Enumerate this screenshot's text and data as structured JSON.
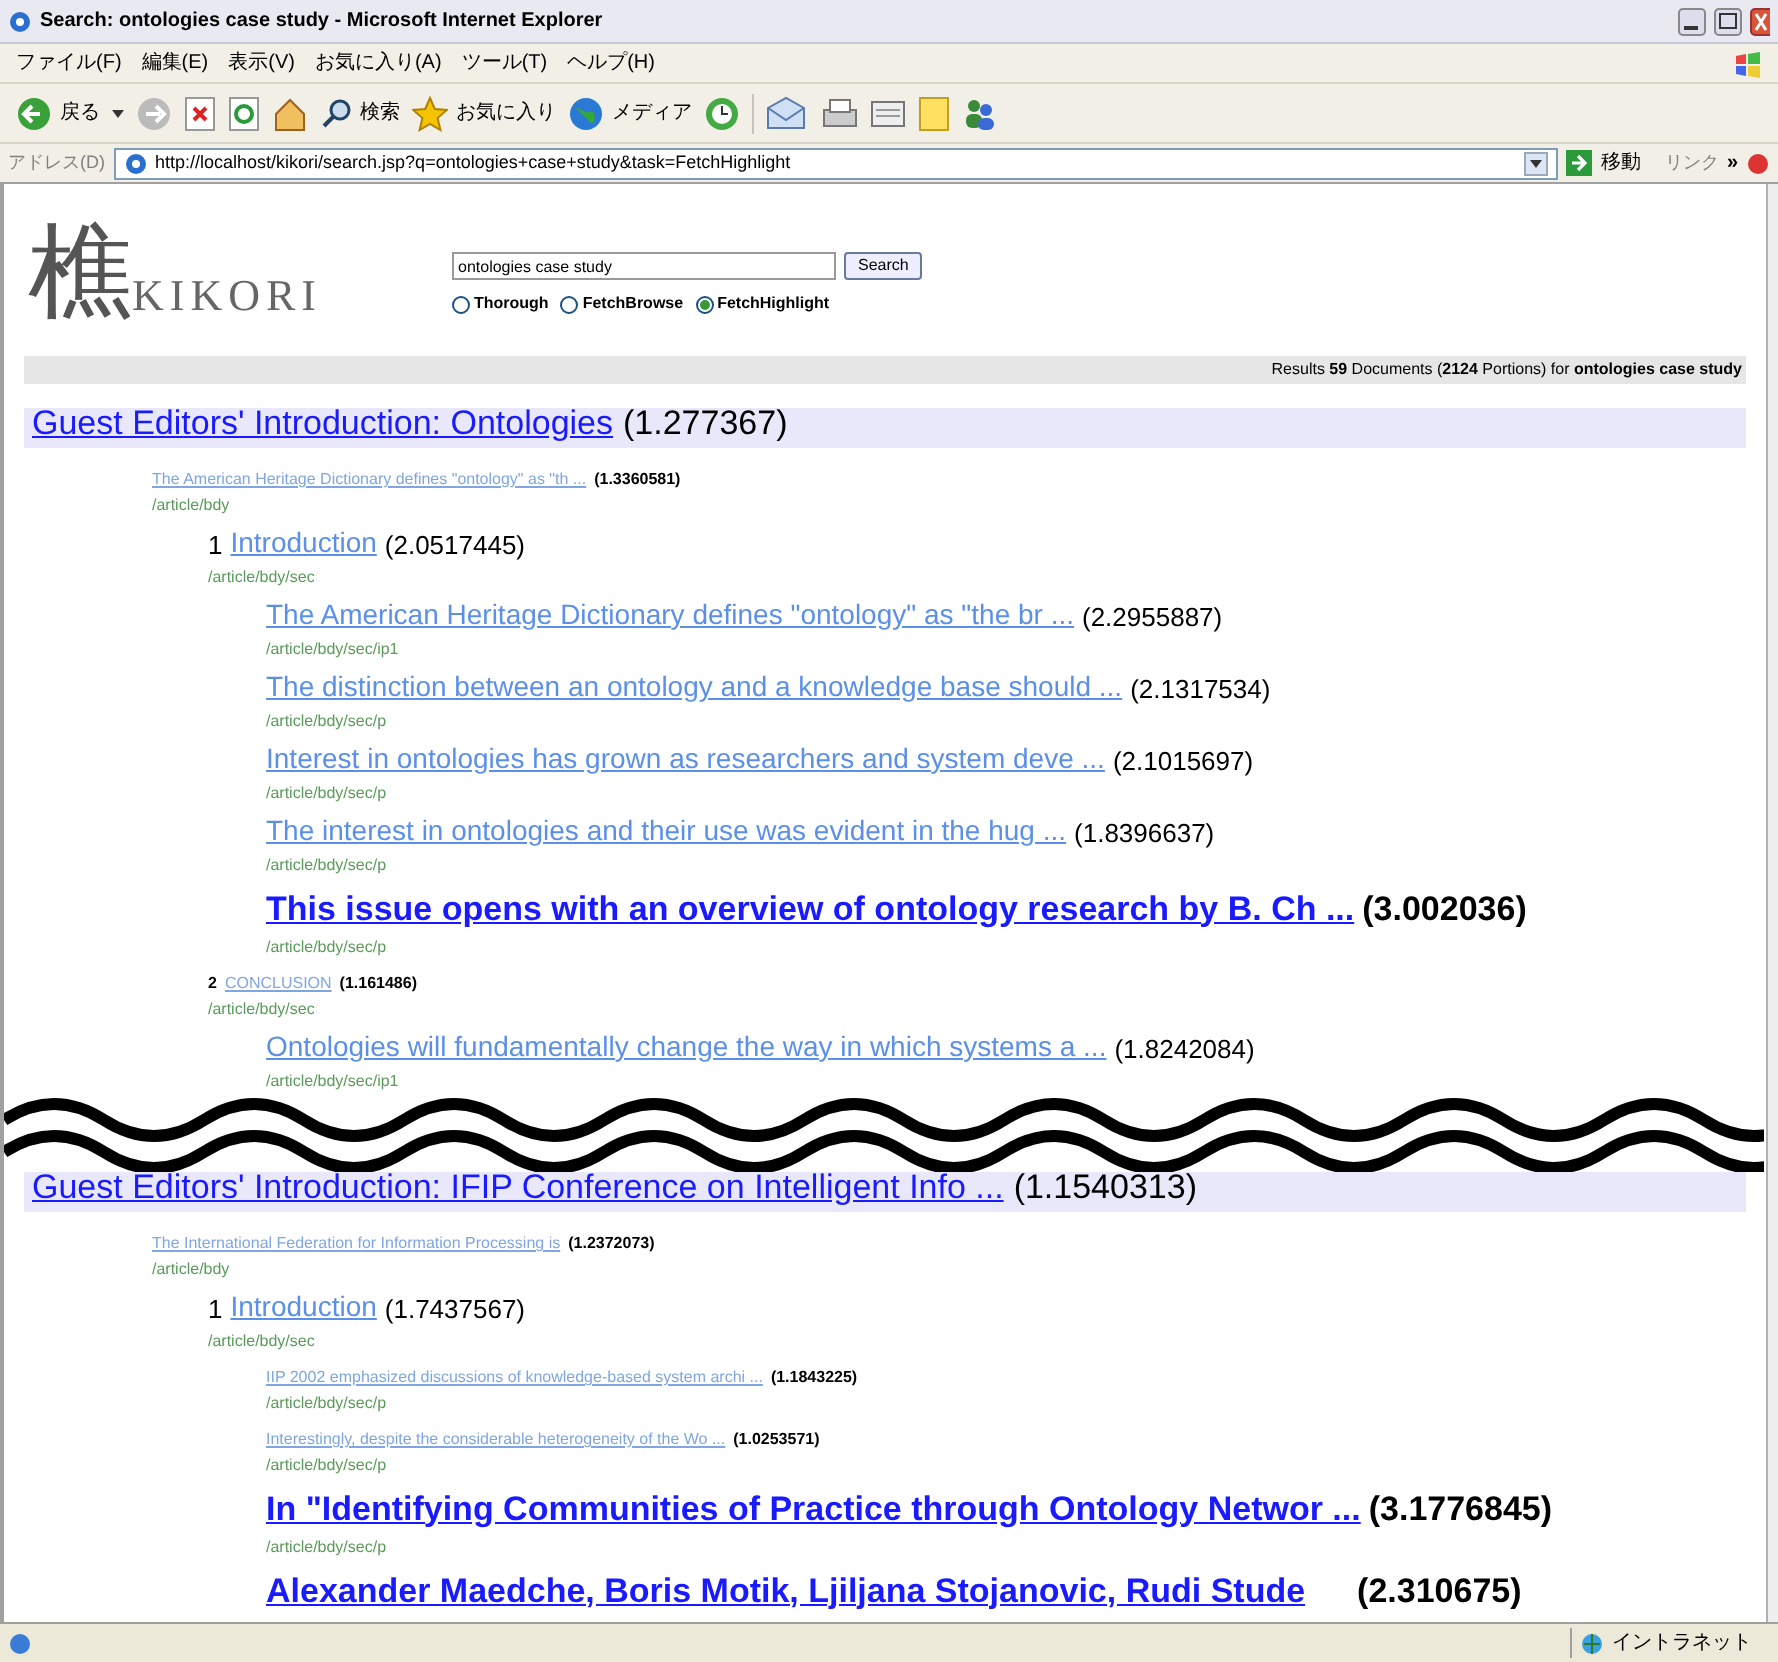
{
  "window": {
    "title": "Search: ontologies case study - Microsoft Internet Explorer"
  },
  "menu": [
    "ファイル(F)",
    "編集(E)",
    "表示(V)",
    "お気に入り(A)",
    "ツール(T)",
    "ヘルプ(H)"
  ],
  "toolbar": {
    "back": "戻る",
    "search": "検索",
    "favorites": "お気に入り",
    "media": "メディア"
  },
  "address_bar": {
    "label": "アドレス(D)",
    "url": "http://localhost/kikori/search.jsp?q=ontologies+case+study&task=FetchHighlight",
    "go": "移動",
    "links": "リンク",
    "more": "»"
  },
  "logo": {
    "mark": "樵",
    "name": "KIKORI"
  },
  "search": {
    "value": "ontologies case study",
    "button": "Search"
  },
  "modes": [
    {
      "label": "Thorough",
      "selected": false
    },
    {
      "label": "FetchBrowse",
      "selected": false
    },
    {
      "label": "FetchHighlight",
      "selected": true
    }
  ],
  "summary": "Results **59** Documents (**2124** Portions) for **ontologies case study**",
  "sections": [
    {
      "title": "Guest Editors' Introduction: Ontologies",
      "score": "(1.277367)",
      "children": [
        {
          "kind": "small",
          "text": "The American Heritage Dictionary defines \"ontology\" as \"th ...",
          "score": "(1.3360581)",
          "path": "/article/bdy",
          "children": [
            {
              "kind": "medium",
              "number": "1",
              "text": "Introduction",
              "score": "(2.0517445)",
              "path": "/article/bdy/sec",
              "children": [
                {
                  "kind": "medium",
                  "text": "The American Heritage Dictionary defines \"ontology\" as \"the br ...",
                  "score": "(2.2955887)",
                  "path": "/article/bdy/sec/ip1"
                },
                {
                  "kind": "medium",
                  "text": "The distinction between an ontology and a knowledge base should ...",
                  "score": "(2.1317534)",
                  "path": "/article/bdy/sec/p"
                },
                {
                  "kind": "medium",
                  "text": "Interest in ontologies has grown as researchers and system deve ...",
                  "score": "(2.1015697)",
                  "path": "/article/bdy/sec/p"
                },
                {
                  "kind": "medium",
                  "text": "The interest in ontologies and their use was evident in the hug ...",
                  "score": "(1.8396637)",
                  "path": "/article/bdy/sec/p"
                },
                {
                  "kind": "large",
                  "text": "This issue opens with an overview of ontology research by B. Ch ...",
                  "score": "(3.002036)",
                  "path": "/article/bdy/sec/p"
                }
              ]
            },
            {
              "kind": "small",
              "number": "2",
              "text": "CONCLUSION",
              "score": "(1.161486)",
              "path": "/article/bdy/sec",
              "children": [
                {
                  "kind": "medium",
                  "text": "Ontologies will fundamentally change the way in which systems a ...",
                  "score": "(1.8242084)",
                  "path": "/article/bdy/sec/ip1"
                }
              ]
            }
          ]
        }
      ]
    },
    {
      "title": "Guest Editors' Introduction: IFIP Conference on Intelligent Info ...",
      "score": "(1.1540313)",
      "children": [
        {
          "kind": "small",
          "text": "The International Federation for Information Processing is",
          "score": "(1.2372073)",
          "path": "/article/bdy",
          "children": [
            {
              "kind": "medium",
              "number": "1",
              "text": "Introduction",
              "score": "(1.7437567)",
              "path": "/article/bdy/sec",
              "children": [
                {
                  "kind": "small",
                  "text": "IIP 2002 emphasized discussions of knowledge-based system archi ...",
                  "score": "(1.1843225)",
                  "path": "/article/bdy/sec/p"
                },
                {
                  "kind": "small",
                  "text": "Interestingly, despite the considerable heterogeneity of the Wo ...",
                  "score": "(1.0253571)",
                  "path": "/article/bdy/sec/p"
                },
                {
                  "kind": "large",
                  "text": "In \"Identifying Communities of Practice through Ontology Networ ...",
                  "score": "(3.1776845)",
                  "path": "/article/bdy/sec/p"
                },
                {
                  "kind": "large",
                  "text": "Alexander Maedche, Boris Motik, Ljiljana Stojanovic, Rudi Stude",
                  "score": "(2.310675)"
                }
              ]
            }
          ]
        }
      ]
    }
  ],
  "status_bar": {
    "zone": "イントラネット"
  }
}
